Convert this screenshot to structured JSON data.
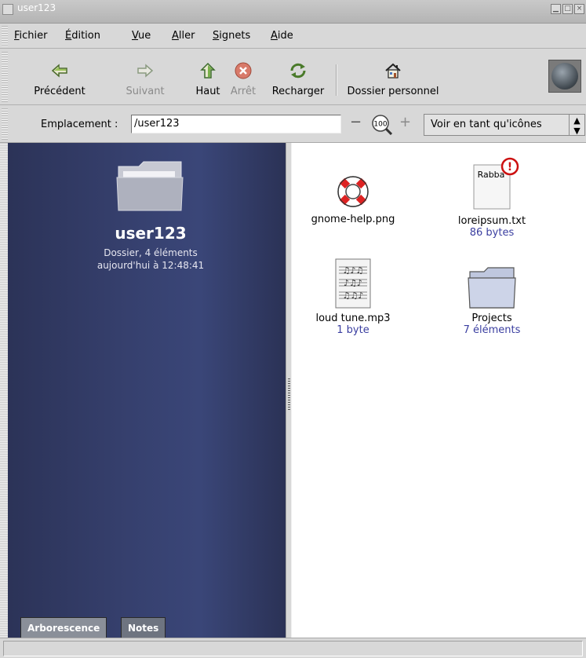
{
  "window": {
    "title": "user123"
  },
  "menubar": {
    "items": [
      {
        "label": "Fichier",
        "mnemonic": "F"
      },
      {
        "label": "Édition",
        "mnemonic": "É"
      },
      {
        "label": "Vue",
        "mnemonic": "V"
      },
      {
        "label": "Aller",
        "mnemonic": "A"
      },
      {
        "label": "Signets",
        "mnemonic": "S"
      },
      {
        "label": "Aide",
        "mnemonic": "A"
      }
    ]
  },
  "toolbar": {
    "back_label": "Précédent",
    "forward_label": "Suivant",
    "up_label": "Haut",
    "stop_label": "Arrêt",
    "reload_label": "Recharger",
    "home_label": "Dossier personnel"
  },
  "location": {
    "label": "Emplacement :",
    "value": "/user123",
    "zoom": "100",
    "view_mode": "Voir en tant qu'icônes"
  },
  "sidebar": {
    "folder_name": "user123",
    "info_line1": "Dossier, 4 éléments",
    "info_line2": "aujourd'hui à 12:48:41",
    "tabs": [
      {
        "label": "Arborescence"
      },
      {
        "label": "Notes"
      }
    ],
    "background_color": "#36406e"
  },
  "files": [
    {
      "name": "gnome-help.png",
      "detail": "",
      "icon": "lifebuoy-icon"
    },
    {
      "name": "loreipsum.txt",
      "detail": "86 bytes",
      "icon": "text-file-icon",
      "preview_text": "Rabba",
      "emblem": "!"
    },
    {
      "name": "loud tune.mp3",
      "detail": "1 byte",
      "icon": "music-file-icon"
    },
    {
      "name": "Projects",
      "detail": "7 éléments",
      "icon": "folder-icon"
    }
  ],
  "colors": {
    "detail_text": "#3a3ea0",
    "emblem": "#cc1111"
  }
}
